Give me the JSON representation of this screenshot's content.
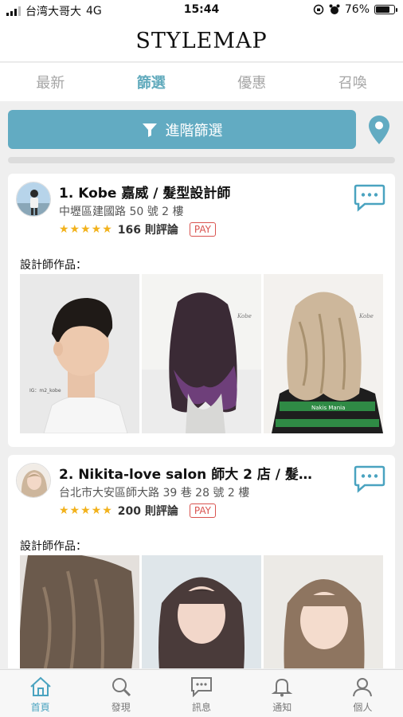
{
  "status_bar": {
    "carrier": "台湾大哥大",
    "network": "4G",
    "time": "15:44",
    "battery": "76%",
    "battery_level": 0.76
  },
  "header": {
    "logo": "STYLEMAP"
  },
  "tabs": [
    {
      "label": "最新",
      "active": false
    },
    {
      "label": "篩選",
      "active": true
    },
    {
      "label": "優惠",
      "active": false
    },
    {
      "label": "召喚",
      "active": false
    }
  ],
  "filter": {
    "label": "進階篩選",
    "icon": "funnel-icon",
    "location_icon": "location-pin-icon"
  },
  "colors": {
    "accent": "#62abc2",
    "active_tab": "#62abbd",
    "star": "#f2b21c",
    "pay": "#d9534f"
  },
  "stylists": [
    {
      "name": "1. Kobe 嘉威 / 髮型設計師",
      "address": "中壢區建國路 50 號 2 樓",
      "stars": "★★★★★",
      "rating": 5,
      "reviews": "166 則評論",
      "pay_badge": "PAY",
      "works_label": "設計師作品：",
      "photo_caption": "IG：m2_kobe",
      "watermark": "Kobe",
      "jacket_text": "Nakis Mania"
    },
    {
      "name": "2. Nikita-love salon 師大 2 店 / 髮…",
      "address": "台北市大安區師大路 39 巷 28 號 2 樓",
      "stars": "★★★★★",
      "rating": 5,
      "reviews": "200 則評論",
      "pay_badge": "PAY",
      "works_label": "設計師作品："
    }
  ],
  "bottom_nav": [
    {
      "label": "首頁",
      "icon": "home-icon",
      "active": true
    },
    {
      "label": "發現",
      "icon": "search-icon",
      "active": false
    },
    {
      "label": "訊息",
      "icon": "chat-icon",
      "active": false
    },
    {
      "label": "通知",
      "icon": "bell-icon",
      "active": false
    },
    {
      "label": "個人",
      "icon": "person-icon",
      "active": false
    }
  ]
}
